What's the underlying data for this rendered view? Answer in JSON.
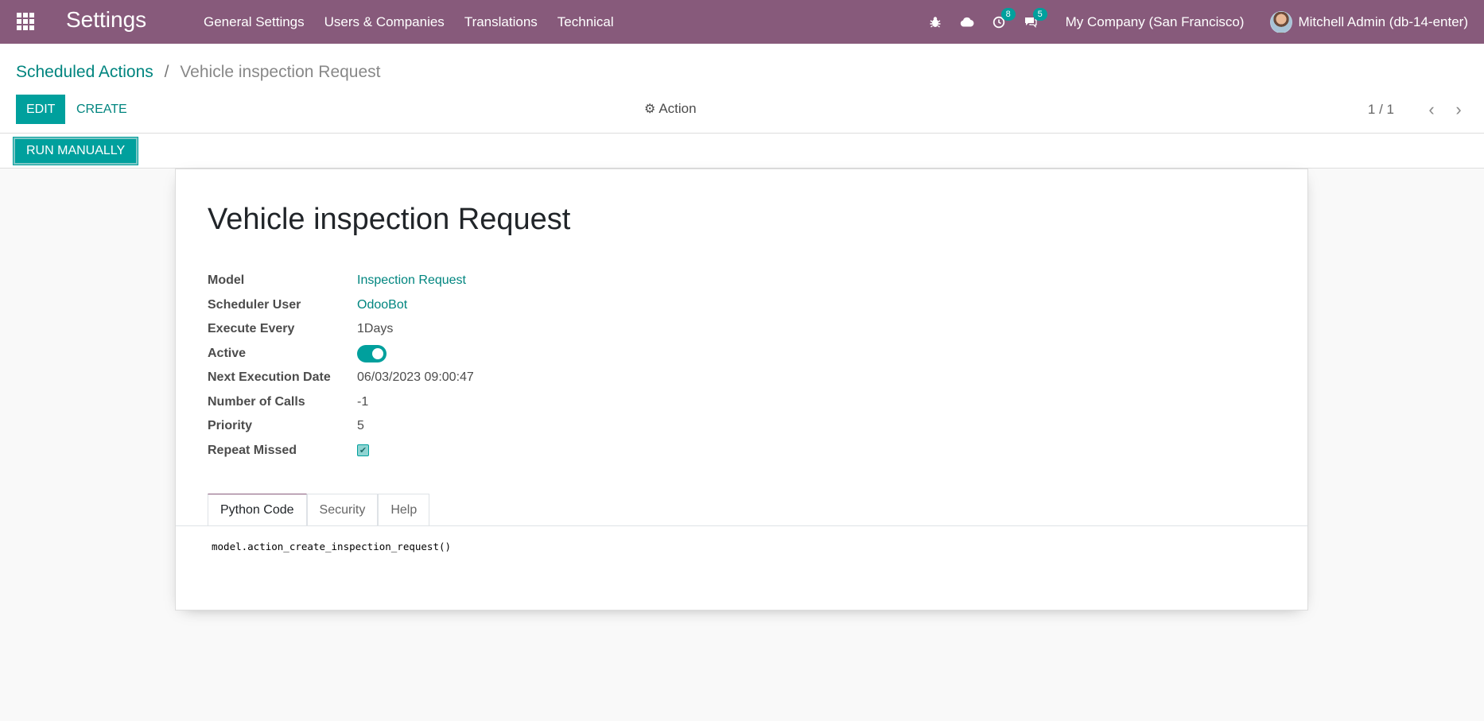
{
  "navbar": {
    "app_title": "Settings",
    "menu": [
      "General Settings",
      "Users & Companies",
      "Translations",
      "Technical"
    ],
    "activity_count": "8",
    "message_count": "5",
    "company": "My Company (San Francisco)",
    "user": "Mitchell Admin (db-14-enter)"
  },
  "breadcrumb": {
    "parent": "Scheduled Actions",
    "separator": "/",
    "current": "Vehicle inspection Request"
  },
  "buttons": {
    "edit": "EDIT",
    "create": "CREATE",
    "action": "Action",
    "run_manually": "RUN MANUALLY"
  },
  "pager": {
    "value": "1 / 1"
  },
  "record": {
    "title": "Vehicle inspection Request",
    "fields": {
      "model": {
        "label": "Model",
        "value": "Inspection Request"
      },
      "scheduler_user": {
        "label": "Scheduler User",
        "value": "OdooBot"
      },
      "execute_every": {
        "label": "Execute Every",
        "value": "1Days"
      },
      "active": {
        "label": "Active",
        "value": true
      },
      "next_execution": {
        "label": "Next Execution Date",
        "value": "06/03/2023 09:00:47"
      },
      "number_of_calls": {
        "label": "Number of Calls",
        "value": "-1"
      },
      "priority": {
        "label": "Priority",
        "value": "5"
      },
      "repeat_missed": {
        "label": "Repeat Missed",
        "value": true
      }
    },
    "tabs": [
      "Python Code",
      "Security",
      "Help"
    ],
    "active_tab": "Python Code",
    "code": "model.action_create_inspection_request()"
  },
  "colors": {
    "navbar": "#875a7b",
    "primary": "#00a09d",
    "link": "#00857f"
  },
  "icons": {
    "apps": "apps-grid-icon",
    "debug": "bug-icon",
    "cloud": "cloud-icon",
    "activity": "clock-icon",
    "messages": "comments-icon",
    "action": "gear-icon",
    "pager_prev": "chevron-left-icon",
    "pager_next": "chevron-right-icon"
  }
}
